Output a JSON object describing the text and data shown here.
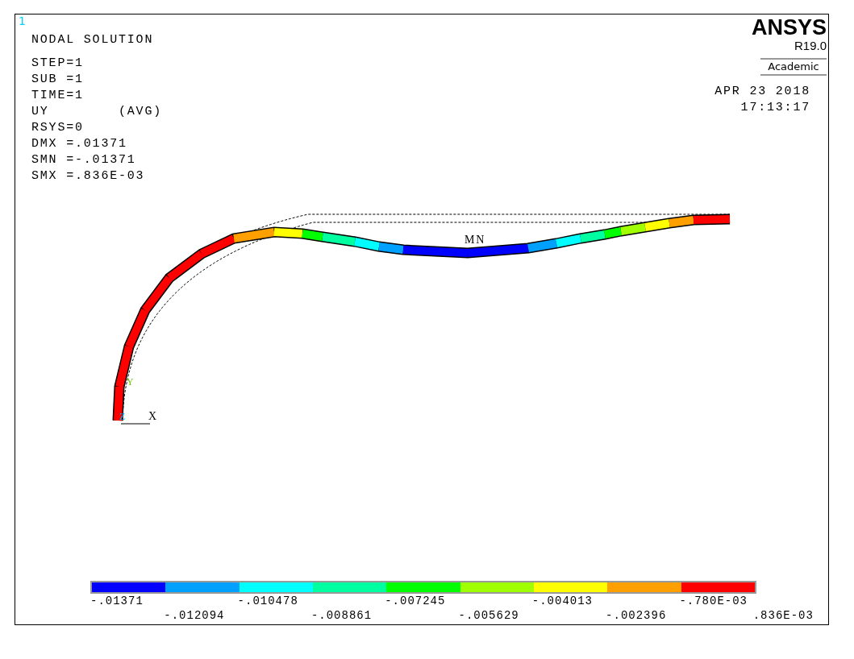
{
  "window_number": "1",
  "title": "NODAL SOLUTION",
  "info_lines": [
    "STEP=1",
    "SUB =1",
    "TIME=1",
    "UY        (AVG)",
    "RSYS=0",
    "DMX =.01371",
    "SMN =-.01371",
    "SMX =.836E-03"
  ],
  "logo": {
    "name": "ANSYS",
    "version": "R19.0",
    "edition": "Academic"
  },
  "date": "APR 23 2018",
  "time": "17:13:17",
  "plot": {
    "min_label": "MN",
    "axis_x": "X",
    "axis_y": "Y",
    "axis_z": "Z"
  },
  "legend": {
    "segments": [
      {
        "color": "#0000ff"
      },
      {
        "color": "#00a0ff"
      },
      {
        "color": "#00ffff"
      },
      {
        "color": "#00ffa0"
      },
      {
        "color": "#00ff00"
      },
      {
        "color": "#a0ff00"
      },
      {
        "color": "#ffff00"
      },
      {
        "color": "#ffa000"
      },
      {
        "color": "#ff0000"
      }
    ],
    "ticks": [
      "-.01371",
      "-.012094",
      "-.010478",
      "-.008861",
      "-.007245",
      "-.005629",
      "-.004013",
      "-.002396",
      "-.780E-03",
      ".836E-03"
    ]
  }
}
